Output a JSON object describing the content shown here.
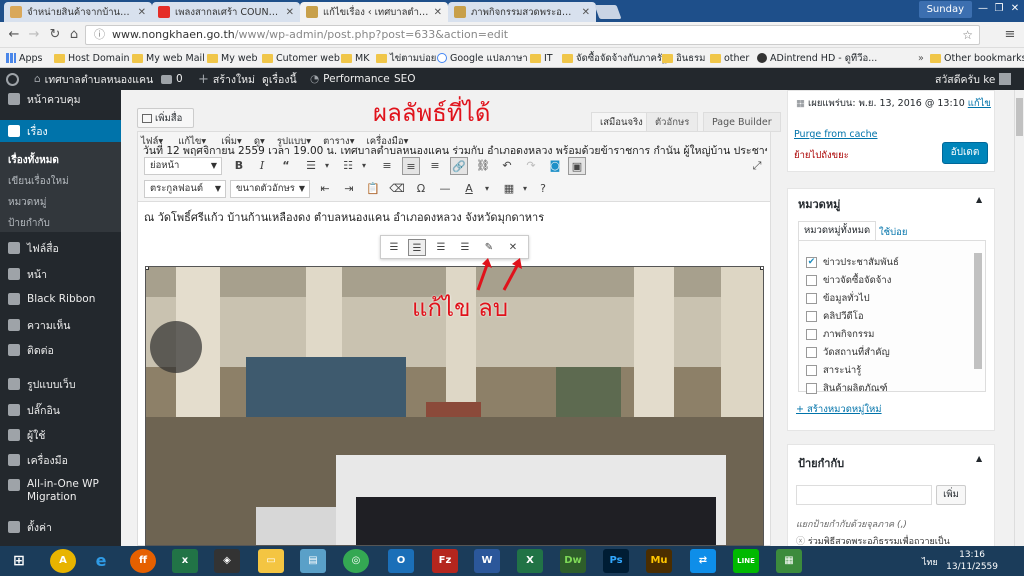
{
  "browser": {
    "tabs": [
      {
        "title": "จำหน่ายสินค้าจากบ้านภรรม"
      },
      {
        "title": "เพลงสากลเศร้า COUNTR"
      },
      {
        "title": "แก้ไขเรื่อง ‹ เทศบาลตำบลหน"
      },
      {
        "title": "ภาพกิจกรรมสวดพระอภิธรรม"
      }
    ],
    "profile": "Sunday",
    "url_host": "www.nongkhaen.go.th",
    "url_path": "/www/wp-admin/post.php?post=633&action=edit",
    "bookmarks": [
      "Apps",
      "Host Domain",
      "My web Mail",
      "My web",
      "Cutomer web",
      "MK",
      "ไข่ตามบ่อย",
      "Google แปลภาษา",
      "IT",
      "จัดซื้อจัดจ้างกับภาครัฐ",
      "อินธรม",
      "other",
      "ADintrend HD - ดูทีวีอ..."
    ],
    "other_bookmarks": "Other bookmarks"
  },
  "adminbar": {
    "site": "เทศบาลตำบลหนองแคน",
    "comments": "0",
    "new": "สร้างใหม่",
    "view": "ดูเรื่องนี้",
    "performance": "Performance",
    "seo": "SEO",
    "greeting": "สวัสดีครับ ke"
  },
  "sidebar": {
    "items": [
      {
        "label": "หน้าควบคุม",
        "icon": "dashboard-icon"
      },
      {
        "label": "เรื่อง",
        "icon": "pin-icon"
      },
      {
        "label": "ไฟล์สื่อ",
        "icon": "media-icon"
      },
      {
        "label": "หน้า",
        "icon": "page-icon"
      },
      {
        "label": "Black Ribbon",
        "icon": "gear-icon"
      },
      {
        "label": "ความเห็น",
        "icon": "comment-icon"
      },
      {
        "label": "ติดต่อ",
        "icon": "mail-icon"
      },
      {
        "label": "รูปแบบเว็บ",
        "icon": "brush-icon"
      },
      {
        "label": "ปลั๊กอิน",
        "icon": "plugin-icon"
      },
      {
        "label": "ผู้ใช้",
        "icon": "user-icon"
      },
      {
        "label": "เครื่องมือ",
        "icon": "wrench-icon"
      },
      {
        "label": "All-in-One WP Migration",
        "icon": "migration-icon"
      },
      {
        "label": "ตั้งค่า",
        "icon": "settings-icon"
      }
    ],
    "sub": [
      "เรื่องทั้งหมด",
      "เขียนเรื่องใหม่",
      "หมวดหมู่",
      "ป้ายกำกับ"
    ]
  },
  "editor": {
    "add_media": "เพิ่มสื่อ",
    "result_heading": "ผลลัพธ์ที่ได้",
    "tabs": [
      "เสมือนจริง",
      "ตัวอักษร",
      "Page Builder"
    ],
    "menubar": [
      "ไฟล์",
      "แก้ไข",
      "เพิ่ม",
      "ดู",
      "รูปแบบ",
      "ตาราง",
      "เครื่องมือ"
    ],
    "overlay_text": "วันที่ 12 พฤศจิกายน 2559 เวลา 19.00 น. เทศบาลตำบลหนองแคน ร่วมกับ อำเภอดงหลวง พร้อมด้วยข้าราชการ กำนัน ผู้ใหญ่บ้าน ประชาชนใน",
    "format_select": "ย่อหน้า",
    "font_family": "ตระกูลฟอนต์",
    "font_size": "ขนาดตัวอักษร",
    "content_line": "ณ วัดโพธิ์ศรีแก้ว บ้านก้านเหลืองดง ตำบลหนองแคน อำเภอดงหลวง จังหวัดมุกดาหาร",
    "annotation": "แก้ไข  ลบ"
  },
  "publish": {
    "published_on": "เผยแพร่บน: พ.ย. 13, 2016 @ 13:10",
    "edit": "แก้ไข",
    "purge": "Purge from cache",
    "trash": "ย้ายไปถังขยะ",
    "update": "อัปเดต"
  },
  "categories": {
    "title": "หมวดหมู่",
    "tab_all": "หมวดหมู่ทั้งหมด",
    "tab_used": "ใช้บ่อย",
    "items": [
      {
        "label": "ข่าวประชาสัมพันธ์",
        "checked": true
      },
      {
        "label": "ข่าวจัดซื้อจัดจ้าง",
        "checked": false
      },
      {
        "label": "ข้อมูลทั่วไป",
        "checked": false
      },
      {
        "label": "คลิปวีดีโอ",
        "checked": false
      },
      {
        "label": "ภาพกิจกรรม",
        "checked": false
      },
      {
        "label": "วัดสถานที่สำคัญ",
        "checked": false
      },
      {
        "label": "สาระน่ารู้",
        "checked": false
      },
      {
        "label": "สินค้าผลิตภัณฑ์",
        "checked": false
      }
    ],
    "add_new": "+ สร้างหมวดหมู่ใหม่"
  },
  "tags": {
    "title": "ป้ายกำกับ",
    "add_button": "เพิ่ม",
    "hint": "แยกป้ายกำกับด้วยจุลภาค (,)",
    "tag": "ร่วมพิธีสวดพระอภิธรรมเพื่อถวายเป็น"
  },
  "taskbar": {
    "apps": [
      "windows-start",
      "autocad",
      "ie",
      "firefox",
      "excel-green",
      "tool",
      "explorer",
      "notes",
      "chrome",
      "outlook",
      "filezilla",
      "word",
      "excel",
      "dreamweaver",
      "photoshop",
      "muse",
      "teamviewer",
      "line",
      "calculator"
    ],
    "lang": "ไทย",
    "time": "13:16",
    "date": "13/11/2559"
  },
  "colors": {
    "wp_dark": "#23282d",
    "wp_blue": "#0073aa",
    "accent_red": "#e0121b"
  }
}
